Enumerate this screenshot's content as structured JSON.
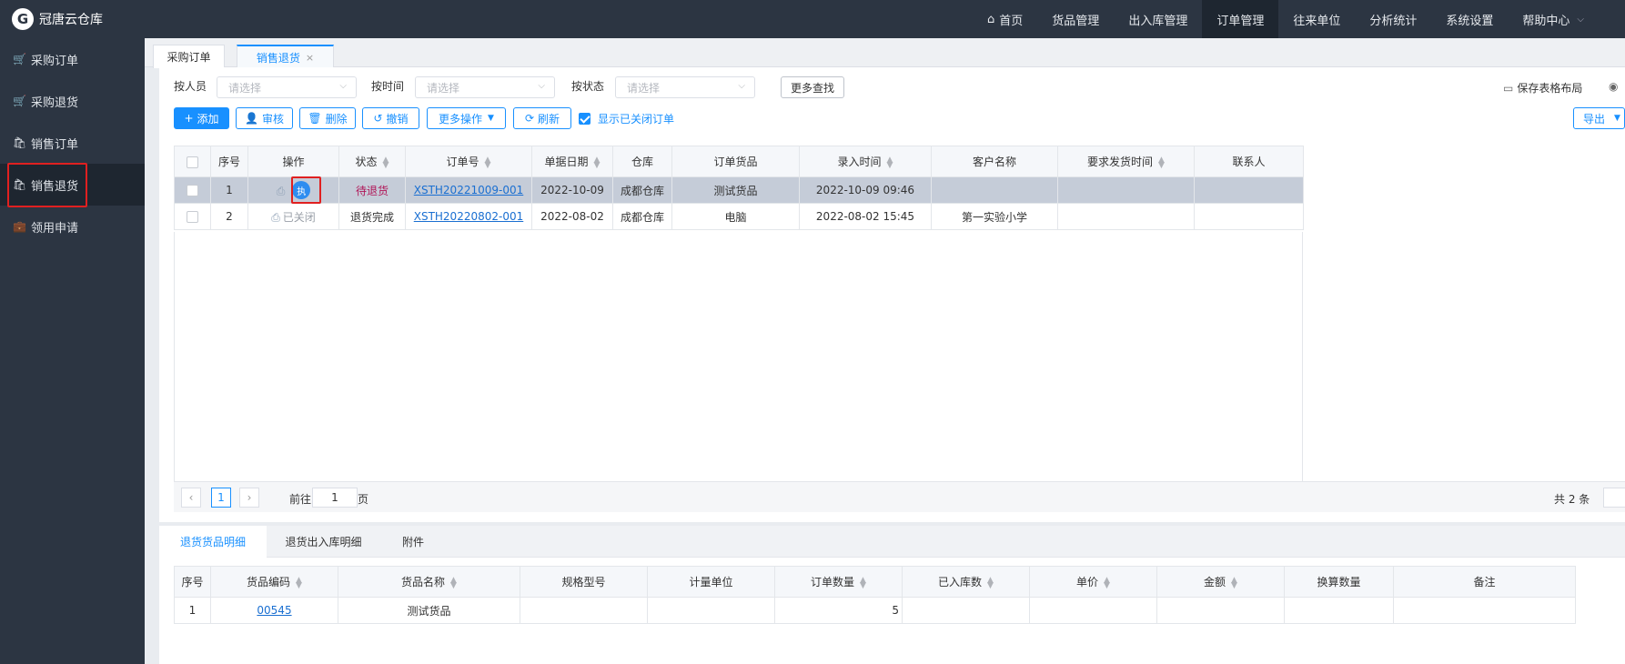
{
  "app": {
    "title": "冠唐云仓库",
    "logo_glyph": "G"
  },
  "sidebar": {
    "items": [
      {
        "label": "采购订单",
        "icon": "cart-icon"
      },
      {
        "label": "采购退货",
        "icon": "cart-icon"
      },
      {
        "label": "销售订单",
        "icon": "bag-icon"
      },
      {
        "label": "销售退货",
        "icon": "bag-icon",
        "active": true
      },
      {
        "label": "领用申请",
        "icon": "briefcase-icon"
      }
    ]
  },
  "topnav": {
    "items": [
      "首页",
      "货品管理",
      "出入库管理",
      "订单管理",
      "往来单位",
      "分析统计",
      "系统设置",
      "帮助中心"
    ],
    "active": "订单管理"
  },
  "tabs": [
    {
      "label": "采购订单"
    },
    {
      "label": "销售退货",
      "active": true,
      "close": "×"
    }
  ],
  "filters": {
    "staff": {
      "label": "按人员",
      "placeholder": "请选择"
    },
    "time": {
      "label": "按时间",
      "placeholder": "请选择"
    },
    "status": {
      "label": "按状态",
      "placeholder": "请选择"
    },
    "more_search": "更多查找",
    "save_layout": "保存表格布局"
  },
  "toolbar": {
    "add": "添加",
    "approve": "审核",
    "delete": "删除",
    "revoke": "撤销",
    "more_ops": "更多操作",
    "refresh": "刷新",
    "show_closed": "显示已关闭订单",
    "export": "导出"
  },
  "grid": {
    "columns": [
      "序号",
      "操作",
      "状态",
      "订单号",
      "单据日期",
      "仓库",
      "订单货品",
      "录入时间",
      "客户名称",
      "要求发货时间",
      "联系人"
    ],
    "rows": [
      {
        "no": "1",
        "op_exec": "执",
        "status": "待退货",
        "order_no": "XSTH20221009-001",
        "date": "2022-10-09",
        "warehouse": "成都仓库",
        "goods": "测试货品",
        "entry_time": "2022-10-09 09:46",
        "customer": "",
        "ship_time": "",
        "contact": ""
      },
      {
        "no": "2",
        "op_closed": "已关闭",
        "status": "退货完成",
        "order_no": "XSTH20220802-001",
        "date": "2022-08-02",
        "warehouse": "成都仓库",
        "goods": "电脑",
        "entry_time": "2022-08-02 15:45",
        "customer": "第一实验小学",
        "ship_time": "",
        "contact": ""
      }
    ]
  },
  "pager": {
    "current": "1",
    "goto_prefix": "前往",
    "goto_value": "1",
    "goto_suffix": "页",
    "total": "共 2 条"
  },
  "detail": {
    "tabs": [
      "退货货品明细",
      "退货出入库明细",
      "附件"
    ],
    "columns": [
      "序号",
      "货品编码",
      "货品名称",
      "规格型号",
      "计量单位",
      "订单数量",
      "已入库数",
      "单价",
      "金额",
      "换算数量",
      "备注"
    ],
    "rows": [
      {
        "no": "1",
        "code": "00545",
        "name": "测试货品",
        "spec": "",
        "unit": "",
        "qty": "5",
        "in_qty": "",
        "price": "",
        "amount": "",
        "conv": "",
        "remark": ""
      }
    ]
  }
}
